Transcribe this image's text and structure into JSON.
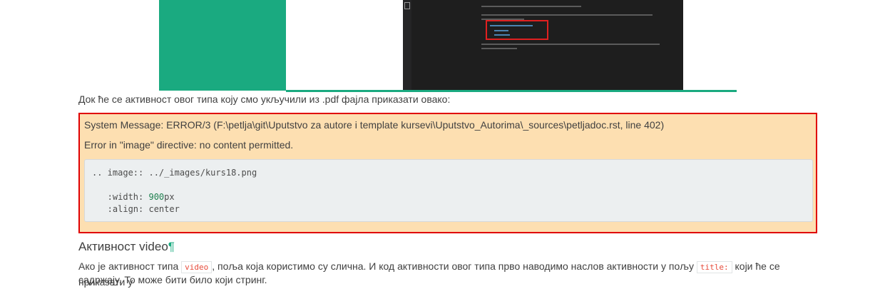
{
  "figure": {
    "alt": "image"
  },
  "intro_text": "Док ће се активност овог типа коју смо укључили из .pdf фајла приказати овако:",
  "error": {
    "system_message": "System Message: ERROR/3 (F:\\petlja\\git\\Uputstvo za autore i template kursevi\\Uputstvo_Autorima\\_sources\\petljadoc.rst, line 402)",
    "detail": "Error in \"image\" directive: no content permitted.",
    "code_line1": ".. image:: ../_images/kurs18.png",
    "code_width_key": "   :width: ",
    "code_width_num": "900",
    "code_width_unit": "px",
    "code_align": "   :align: center"
  },
  "section": {
    "title": "Активност video",
    "pilcrow": "¶"
  },
  "paragraph": {
    "part1": "Ако је активност типа ",
    "code1": "video",
    "part2": ", поља која користимо су слична. И код активности овог типа прво наводимо наслов активности у пољу ",
    "code2": "title:",
    "part3": " који ће се приказати у",
    "line2": "садржају. То може бити било који стринг."
  }
}
